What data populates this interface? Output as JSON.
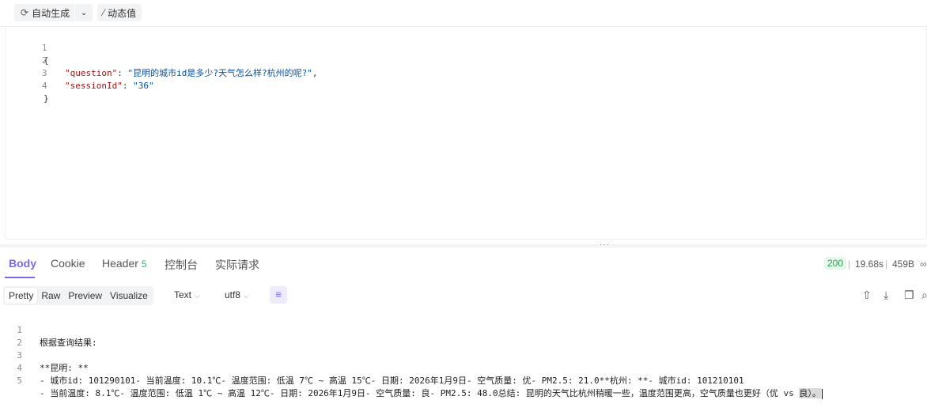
{
  "toolbar": {
    "auto_generate_label": "自动生成",
    "dynamic_value_label": "动态值"
  },
  "request_body": {
    "lines": [
      {
        "num": "1",
        "text": "{"
      },
      {
        "num": "2",
        "key": "\"question\"",
        "sep": ": ",
        "value": "\"昆明的城市id是多少?天气怎么样?杭州的呢?\"",
        "tail": ","
      },
      {
        "num": "3",
        "key": "\"sessionId\"",
        "sep": ": ",
        "value": "\"36\"",
        "tail": ""
      },
      {
        "num": "4",
        "text": "}"
      }
    ]
  },
  "response_tabs": {
    "body": "Body",
    "cookie": "Cookie",
    "header": "Header",
    "header_count": "5",
    "console": "控制台",
    "actual_request": "实际请求"
  },
  "response_meta": {
    "status": "200",
    "time": "19.68s",
    "size": "459B"
  },
  "format_bar": {
    "views": [
      "Pretty",
      "Raw",
      "Preview",
      "Visualize"
    ],
    "active_view": "Pretty",
    "type_select": "Text",
    "encoding_select": "utf8"
  },
  "response_body": {
    "lines": [
      {
        "num": "1",
        "text": "根据查询结果:"
      },
      {
        "num": "2",
        "text": ""
      },
      {
        "num": "3",
        "text": "**昆明: **"
      },
      {
        "num": "4",
        "text": "- 城市id: 101290101- 当前温度: 10.1℃- 温度范围: 低温 7℃ ~ 高温 15℃- 日期: 2026年1月9日- 空气质量: 优- PM2.5: 21.0**杭州: **- 城市id: 101210101"
      },
      {
        "num": "5",
        "text": "- 当前温度: 8.1℃- 温度范围: 低温 1℃ ~ 高温 12℃- 日期: 2026年1月9日- 空气质量: 良- PM2.5: 48.0总结: 昆明的天气比杭州稍暖一些，温度范围更高，空气质量也更好（优 vs ",
        "highlight": "良）。"
      }
    ]
  },
  "colors": {
    "accent": "#7b68ee",
    "status_ok": "#2e9b57",
    "json_key": "#a31515",
    "json_string": "#0451a5"
  }
}
